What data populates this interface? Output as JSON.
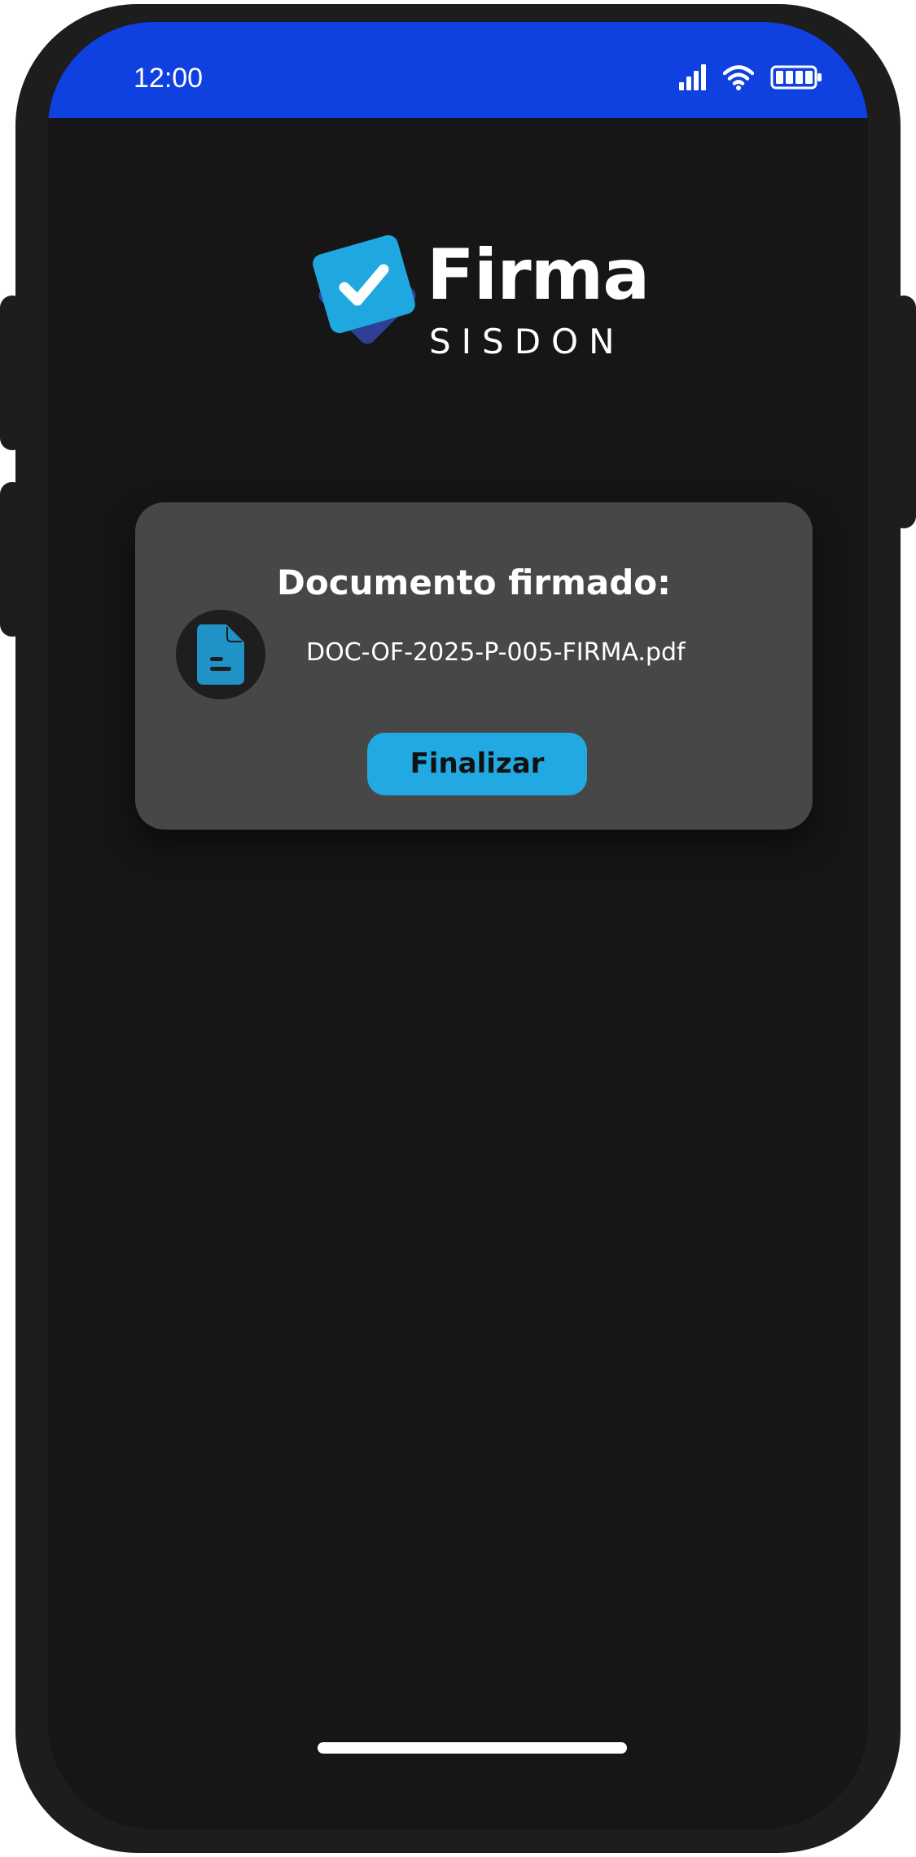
{
  "status_bar": {
    "time": "12:00",
    "icons": [
      "signal-icon",
      "wifi-icon",
      "battery-icon"
    ],
    "background": "#0f40e0"
  },
  "logo": {
    "title": "Firma",
    "subtitle": "SISDON"
  },
  "card": {
    "title": "Documento firmado:",
    "file_icon": "document-icon",
    "file_name": "DOC-OF-2025-P-005-FIRMA.pdf",
    "button_label": "Finalizar",
    "accent": "#22a9e1"
  }
}
